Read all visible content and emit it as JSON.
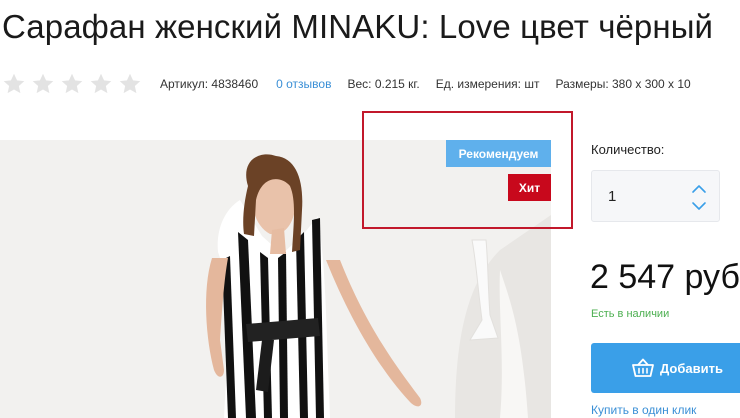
{
  "product": {
    "title": "Сарафан женский MINAKU: Love цвет чёрный"
  },
  "meta": {
    "rating": 0,
    "rating_max": 5,
    "article": "Артикул: 4838460",
    "reviews": "0 отзывов",
    "weight": "Вес: 0.215 кг.",
    "unit": "Ед. измерения: шт",
    "sizes": "Размеры: 380 x 300 x 10"
  },
  "badges": {
    "recommend": "Рекомендуем",
    "hit": "Хит"
  },
  "purchase": {
    "quantity_label": "Количество:",
    "quantity_value": "1",
    "price": "2 547 руб.",
    "stock_status": "Есть в наличии",
    "add_label": "Добавить",
    "one_click_label": "Купить в один клик"
  },
  "colors": {
    "accent_blue": "#3a9fe8",
    "badge_recommend": "#5fb0ec",
    "badge_hit": "#c8081c",
    "highlight_frame": "#c2182b",
    "stock_green": "#4caf50",
    "link_blue": "#3a8fd6"
  },
  "icons": {
    "rating_star": "star-icon",
    "quantity_up": "chevron-up-icon",
    "quantity_down": "chevron-down-icon",
    "add_to_cart": "basket-icon"
  }
}
